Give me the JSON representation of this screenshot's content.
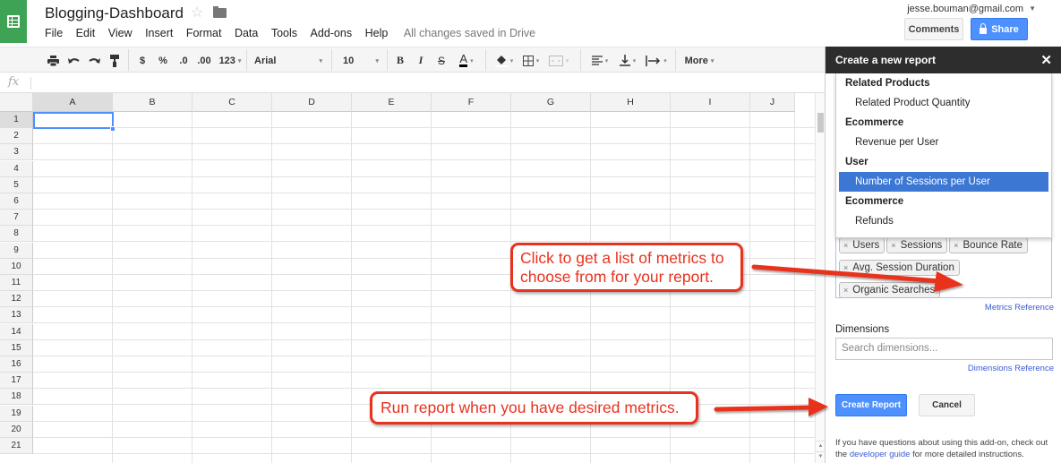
{
  "app": {
    "doc_title": "Blogging-Dashboard",
    "icons": {
      "logo": "sheets-logo-icon",
      "star": "star-icon",
      "folder": "folder-icon"
    },
    "star_glyph": "☆",
    "menu": [
      "File",
      "Edit",
      "View",
      "Insert",
      "Format",
      "Data",
      "Tools",
      "Add-ons",
      "Help"
    ],
    "save_status": "All changes saved in Drive",
    "user_email": "jesse.bouman@gmail.com",
    "user_caret": "▼",
    "comments_label": "Comments",
    "share_label": "Share"
  },
  "toolbar": {
    "currency": "$",
    "percent": "%",
    "decrease_decimals": ".0",
    "increase_decimals": ".00",
    "number_format": "123",
    "font_family": "Arial",
    "font_size": "10",
    "bold": "B",
    "italic": "I",
    "strikethrough": "S",
    "text_color": "A",
    "more_label": "More",
    "caret": "▾"
  },
  "formula_bar": {
    "fx_label": "fx",
    "value": ""
  },
  "sheet": {
    "columns": [
      "A",
      "B",
      "C",
      "D",
      "E",
      "F",
      "G",
      "H",
      "I",
      "J"
    ],
    "rows": [
      "1",
      "2",
      "3",
      "4",
      "5",
      "6",
      "7",
      "8",
      "9",
      "10",
      "11",
      "12",
      "13",
      "14",
      "15",
      "16",
      "17",
      "18",
      "19",
      "20",
      "21"
    ],
    "selected_cell": "A1"
  },
  "sidebar": {
    "title": "Create a new report",
    "close_glyph": "✕",
    "dropdown": [
      {
        "type": "group",
        "label": "Related Products"
      },
      {
        "type": "option",
        "label": "Related Product Quantity"
      },
      {
        "type": "group",
        "label": "Ecommerce"
      },
      {
        "type": "option",
        "label": "Revenue per User"
      },
      {
        "type": "group",
        "label": "User"
      },
      {
        "type": "option",
        "label": "Number of Sessions per User",
        "selected": true
      },
      {
        "type": "group",
        "label": "Ecommerce"
      },
      {
        "type": "option",
        "label": "Refunds"
      }
    ],
    "metrics_chips": [
      "Users",
      "Sessions",
      "Bounce Rate",
      "Avg. Session Duration",
      "Organic Searches"
    ],
    "chip_remove_glyph": "×",
    "metrics_reference": "Metrics Reference",
    "dimensions_label": "Dimensions",
    "dimensions_placeholder": "Search dimensions...",
    "dimensions_reference": "Dimensions Reference",
    "create_label": "Create Report",
    "cancel_label": "Cancel",
    "help_before": "If you have questions about using this add-on, check out the ",
    "help_link": "developer guide",
    "help_after": " for more detailed instructions."
  },
  "annotations": {
    "callout_metrics": "Click to get a list of metrics to choose from for your report.",
    "callout_run": "Run report when you have desired metrics.",
    "color": "#e8321d"
  }
}
